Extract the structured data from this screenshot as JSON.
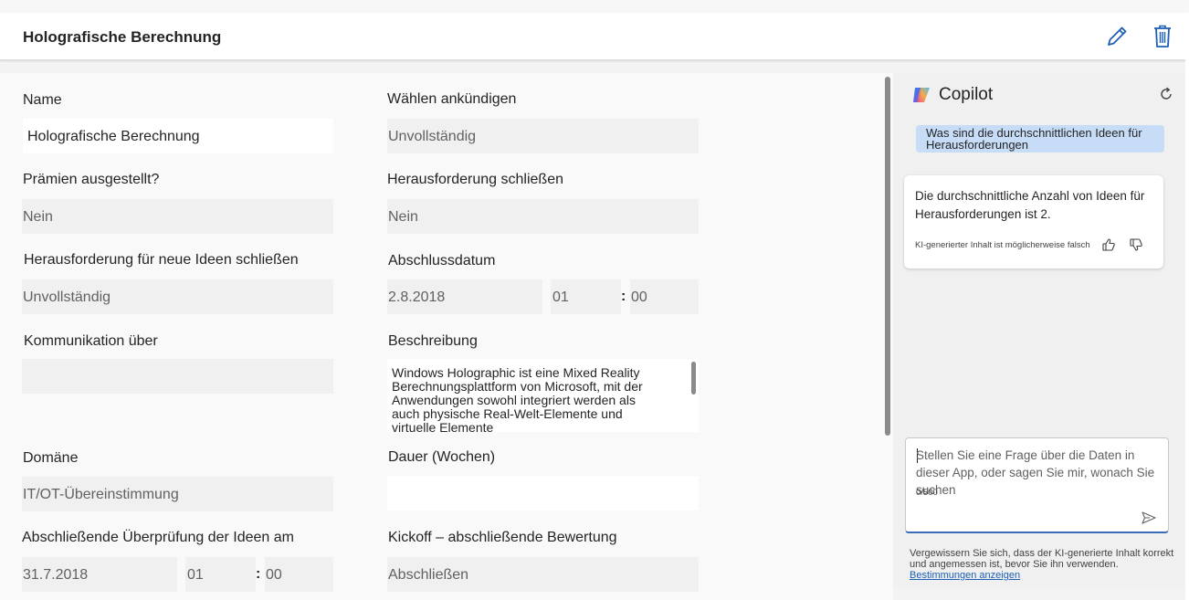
{
  "header": {
    "title": "Holografische Berechnung"
  },
  "form": {
    "name_label": "Name",
    "name_value": "Holografische Berechnung",
    "waehlen_label": "Wählen ankündigen",
    "waehlen_value": "Unvollständig",
    "praemien_label": "Prämien ausgestellt?",
    "praemien_value": "Nein",
    "herausforderung_schliessen_label": "Herausforderung schließen",
    "herausforderung_schliessen_value": "Nein",
    "neue_ideen_label": "Herausforderung für neue Ideen schließen",
    "neue_ideen_value": "Unvollständig",
    "abschlussdatum_label": "Abschlussdatum",
    "abschlussdatum_date": "2.8.2018",
    "abschlussdatum_hour": "01",
    "abschlussdatum_minute": "00",
    "kommunikation_label": "Kommunikation über",
    "kommunikation_value": "",
    "beschreibung_label": "Beschreibung",
    "beschreibung_value": "Windows Holographic ist eine Mixed Reality Berechnungsplattform von Microsoft, mit der Anwendungen sowohl integriert werden als auch physische Real-Welt-Elemente und virtuelle Elemente",
    "domaene_label": "Domäne",
    "domaene_value": "IT/OT-Übereinstimmung",
    "dauer_label": "Dauer (Wochen)",
    "dauer_value": "",
    "ueberpruefung_label": "Abschließende Überprüfung der Ideen am",
    "ueberpruefung_date": "31.7.2018",
    "ueberpruefung_hour": "01",
    "ueberpruefung_minute": "00",
    "kickoff_label": "Kickoff – abschließende Bewertung",
    "kickoff_value": "Abschließen",
    "time_separator": ":"
  },
  "copilot": {
    "title": "Copilot",
    "user_message": "Was sind die durchschnittlichen Ideen für Herausforderungen",
    "bot_message": "Die durchschnittliche Anzahl von Ideen für Herausforderungen ist 2.",
    "bot_disclaimer": "KI-generierter Inhalt ist möglicherweise falsch",
    "input_placeholder": "Stellen Sie eine Frage über die Daten in dieser App, oder sagen Sie mir, wonach Sie suchen",
    "char_count": "0/500",
    "footer_text": "Vergewissern Sie sich, dass der KI-generierte Inhalt korrekt und angemessen ist, bevor Sie ihn verwenden.",
    "footer_link": "Bestimmungen anzeigen"
  },
  "icons": {
    "edit": "pencil-icon",
    "delete": "trash-icon",
    "copilot_logo": "copilot-logo-icon",
    "refresh": "refresh-icon",
    "thumbs_up": "thumbs-up-icon",
    "thumbs_down": "thumbs-down-icon",
    "send": "send-icon"
  },
  "colors": {
    "accent": "#1d5fb4",
    "user_bubble": "#c7ddf7",
    "field_bg": "#f0f0f0"
  }
}
